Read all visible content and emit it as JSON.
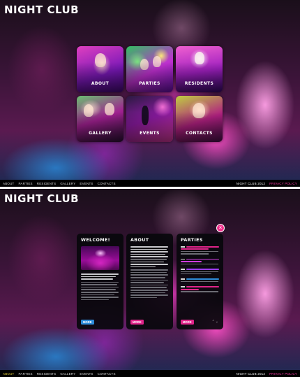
{
  "brand": {
    "logo": "NIGHT CLUB"
  },
  "tiles": [
    {
      "label": "ABOUT",
      "icon": "crowd-photo-icon"
    },
    {
      "label": "PARTIES",
      "icon": "crowd-photo-icon"
    },
    {
      "label": "RESIDENTS",
      "icon": "dj-photo-icon"
    },
    {
      "label": "GALLERY",
      "icon": "crowd-photo-icon"
    },
    {
      "label": "EVENTS",
      "icon": "dancer-photo-icon"
    },
    {
      "label": "CONTACTS",
      "icon": "woman-photo-icon"
    }
  ],
  "footer": {
    "nav": [
      "ABOUT",
      "PARTIES",
      "RESIDENTS",
      "GALLERY",
      "EVENTS",
      "CONTACTS"
    ],
    "copyright": "NIGHT CLUB 2012",
    "privacy": "PRIVACY POLICY"
  },
  "cards": {
    "welcome": {
      "title": "WELCOME!",
      "more": "MORE"
    },
    "about": {
      "title": "ABOUT",
      "more": "MORE"
    },
    "parties": {
      "title": "PARTIES",
      "more": "MORE"
    }
  },
  "colors": {
    "accent_pink": "#e0248a",
    "accent_blue": "#2d8bd8",
    "active_nav": "#e8d23a",
    "party_title_colors": [
      "#e0248a",
      "#d03ce0",
      "#9e3cff",
      "#2d8bd8",
      "#e0248a"
    ]
  }
}
